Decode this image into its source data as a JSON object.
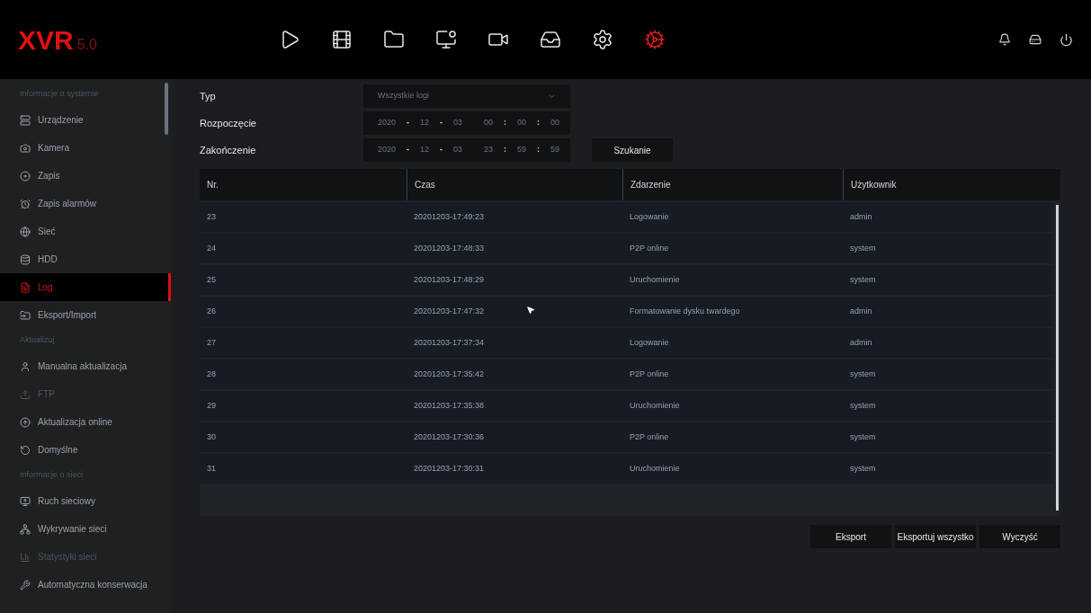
{
  "logo": {
    "name": "XVR",
    "version": "5.0"
  },
  "nav": [
    {
      "selected": false
    },
    {
      "selected": false
    },
    {
      "selected": false
    },
    {
      "selected": false
    },
    {
      "selected": false
    },
    {
      "selected": false
    },
    {
      "selected": false
    },
    {
      "selected": true
    }
  ],
  "sidebar": [
    {
      "heading": "Informacje o systemie",
      "items": [
        {
          "label": "Urządzenie",
          "selected": false,
          "disabled": false
        },
        {
          "label": "Kamera",
          "selected": false,
          "disabled": false
        },
        {
          "label": "Zapis",
          "selected": false,
          "disabled": false
        },
        {
          "label": "Zapis alarmów",
          "selected": false,
          "disabled": false
        },
        {
          "label": "Sieć",
          "selected": false,
          "disabled": false
        },
        {
          "label": "HDD",
          "selected": false,
          "disabled": false
        },
        {
          "label": "Log",
          "selected": true,
          "disabled": false
        },
        {
          "label": "Eksport/Import",
          "selected": false,
          "disabled": false
        }
      ]
    },
    {
      "heading": "Aktualizuj",
      "items": [
        {
          "label": "Manualna aktualizacja",
          "selected": false,
          "disabled": false
        },
        {
          "label": "FTP",
          "selected": false,
          "disabled": true
        },
        {
          "label": "Aktualizacja online",
          "selected": false,
          "disabled": false
        },
        {
          "label": "Domyślne",
          "selected": false,
          "disabled": false
        }
      ]
    },
    {
      "heading": "Informacje o sieci",
      "items": [
        {
          "label": "Ruch sieciowy",
          "selected": false,
          "disabled": false
        },
        {
          "label": "Wykrywanie sieci",
          "selected": false,
          "disabled": false
        },
        {
          "label": "Statystyki sieci",
          "selected": false,
          "disabled": true
        },
        {
          "label": "Automatyczna konserwacja",
          "selected": false,
          "disabled": false
        }
      ]
    }
  ],
  "form": {
    "type": {
      "label": "Typ",
      "value": "Wszystkie logi"
    },
    "start": {
      "label": "Rozpoczęcie",
      "parts": [
        "2020",
        "12",
        "03",
        "00",
        "00",
        "00"
      ]
    },
    "end": {
      "label": "Zakończenie",
      "parts": [
        "2020",
        "12",
        "03",
        "23",
        "59",
        "59"
      ]
    },
    "search_button": "Szukanie"
  },
  "table": {
    "columns": [
      "Nr.",
      "Czas",
      "Zdarzenie",
      "Użytkownik"
    ],
    "rows": [
      [
        "23",
        "20201203-17:49:23",
        "Logowanie",
        "admin"
      ],
      [
        "24",
        "20201203-17:48:33",
        "P2P online",
        "system"
      ],
      [
        "25",
        "20201203-17:48:29",
        "Uruchomienie",
        "system"
      ],
      [
        "26",
        "20201203-17:47:32",
        "Formatowanie dysku twardego",
        "admin"
      ],
      [
        "27",
        "20201203-17:37:34",
        "Logowanie",
        "admin"
      ],
      [
        "28",
        "20201203-17:35:42",
        "P2P online",
        "system"
      ],
      [
        "29",
        "20201203-17:35:38",
        "Uruchomienie",
        "system"
      ],
      [
        "30",
        "20201203-17:30:36",
        "P2P online",
        "system"
      ],
      [
        "31",
        "20201203-17:30:31",
        "Uruchomienie",
        "system"
      ]
    ]
  },
  "buttons": [
    "Eksport",
    "Eksportuj wszystko",
    "Wyczyść"
  ],
  "date_separators": [
    "-",
    "-",
    ":",
    ":"
  ]
}
